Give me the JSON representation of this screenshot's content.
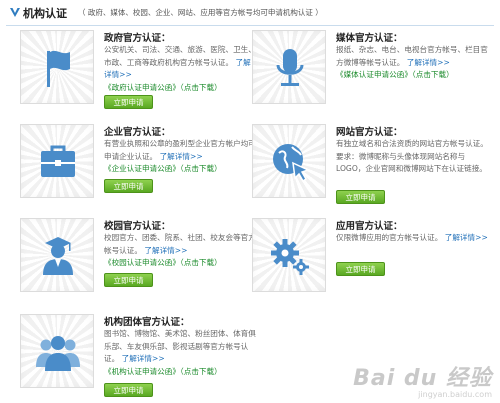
{
  "header": {
    "title": "机构认证",
    "subtitle": "（ 政府、媒体、校园、企业、网站、应用等官方帐号均可申请机构认证 ）"
  },
  "more_label": "了解详情>>",
  "apply_label": "立即申请",
  "cards": [
    {
      "title": "政府官方认证：",
      "desc": "公安机关、司法、交通、旅游、医院、卫生、市政、工商等政府机构官方帐号认证。",
      "download": "《政府认证申请公函》（点击下载）"
    },
    {
      "title": "媒体官方认证：",
      "desc": "报纸、杂志、电台、电视台官方帐号、栏目官方微博等帐号认证。",
      "download": "《媒体认证申请公函》（点击下载）"
    },
    {
      "title": "企业官方认证：",
      "desc": "有营业执照和公章的盈利型企业官方帐户均可申请企业认证。",
      "download": "《企业认证申请公函》（点击下载）"
    },
    {
      "title": "网站官方认证：",
      "desc": "有独立域名和合法资质的网站官方帐号认证。要求：微博昵称与头像体现网站名称与LOGO，企业官网和微博网站下在认证链接。"
    },
    {
      "title": "校园官方认证：",
      "desc": "校园官方、团委、院系、社团、校友会等官方帐号认证。",
      "download": "《校园认证申请公函》（点击下载）"
    },
    {
      "title": "应用官方认证：",
      "desc": "仅限微博应用的官方帐号认证。"
    },
    {
      "title": "机构团体官方认证：",
      "desc": "图书馆、博物馆、美术馆、粉丝团体、体育俱乐部、车友俱乐部、影视话剧等官方帐号认证。",
      "download": "《机构认证申请公函》（点击下载）"
    }
  ],
  "watermark": {
    "brand": "Bai du 经验",
    "url": "jingyan.baidu.com"
  },
  "icons": [
    "flag-icon",
    "microphone-icon",
    "briefcase-icon",
    "globe-cursor-icon",
    "graduate-icon",
    "gear-icon",
    "group-icon"
  ],
  "colors": {
    "icon_blue": "#4a8cc9",
    "link_blue": "#1f6fb8",
    "download_green": "#1a8a2a",
    "button_green": "#5aa822"
  }
}
